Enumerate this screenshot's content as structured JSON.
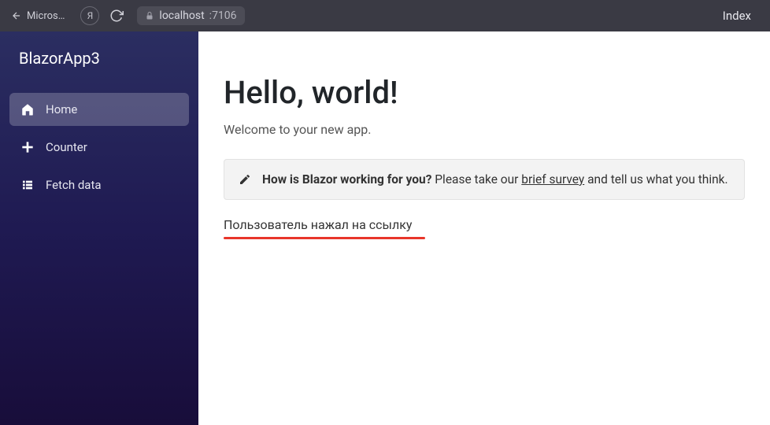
{
  "browser": {
    "tab_label": "Micros…",
    "yandex_label": "Я",
    "url_host": "localhost",
    "url_port": ":7106",
    "right_label": "Index"
  },
  "sidebar": {
    "brand": "BlazorApp3",
    "items": [
      {
        "label": "Home"
      },
      {
        "label": "Counter"
      },
      {
        "label": "Fetch data"
      }
    ]
  },
  "main": {
    "heading": "Hello, world!",
    "welcome": "Welcome to your new app.",
    "survey_bold": "How is Blazor working for you?",
    "survey_pre": " Please take our ",
    "survey_link": "brief survey",
    "survey_post": " and tell us what you think.",
    "clicked_message": "Пользователь нажал на ссылку"
  }
}
